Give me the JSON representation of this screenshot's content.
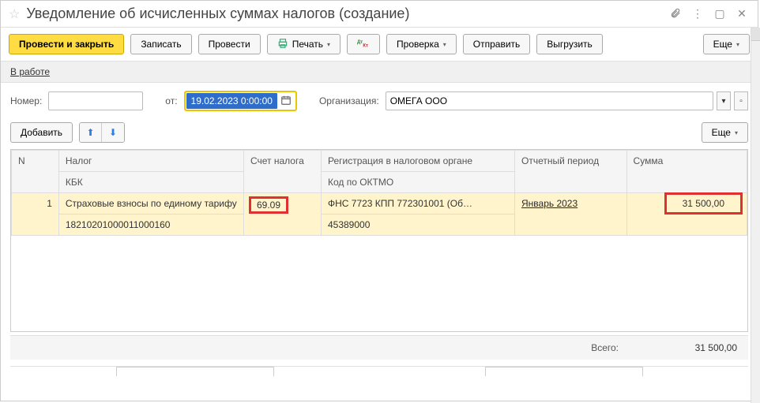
{
  "title": "Уведомление об исчисленных суммах налогов (создание)",
  "toolbar": {
    "execute_close": "Провести и закрыть",
    "save": "Записать",
    "execute": "Провести",
    "print": "Печать",
    "check": "Проверка",
    "send": "Отправить",
    "export": "Выгрузить",
    "more": "Еще"
  },
  "link": "В работе",
  "form": {
    "number_label": "Номер:",
    "date_label": "от:",
    "date_value": "19.02.2023  0:00:00",
    "org_label": "Организация:",
    "org_value": "ОМЕГА ООО"
  },
  "sub": {
    "add": "Добавить",
    "more": "Еще"
  },
  "headers": {
    "n": "N",
    "tax": "Налог",
    "kbk": "КБК",
    "acct": "Счет налога",
    "reg": "Регистрация в налоговом органе",
    "oktmo": "Код по ОКТМО",
    "period": "Отчетный период",
    "sum": "Сумма"
  },
  "rows": [
    {
      "n": "1",
      "tax": "Страховые взносы по единому тарифу",
      "kbk": "18210201000011000160",
      "acct": "69.09",
      "reg": "ФНС 7723 КПП 772301001 (Об…",
      "oktmo": "45389000",
      "period": "Январь 2023",
      "sum": "31 500,00"
    }
  ],
  "footer": {
    "label": "Всего:",
    "value": "31 500,00"
  }
}
